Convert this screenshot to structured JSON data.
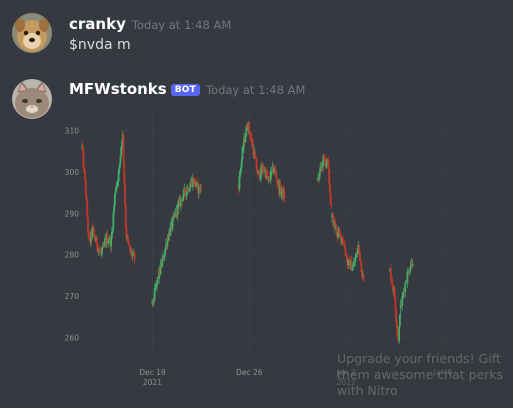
{
  "messages": [
    {
      "author": "cranky",
      "timestamp": "Today at 1:48 AM",
      "text": "$nvda m"
    },
    {
      "author": "MFWstonks",
      "badge": "BOT",
      "timestamp": "Today at 1:48 AM"
    }
  ],
  "nitro_overlay": {
    "text": "Upgrade your friends! Gift them awesome chat perks with Nitro"
  },
  "colors": {
    "up": "#3dae6b",
    "down": "#c0392b",
    "background": "#36393f",
    "bot_badge": "#5865f2"
  },
  "chart_data": {
    "type": "candlestick",
    "ylim": [
      255,
      315
    ],
    "yticks": [
      260,
      270,
      280,
      290,
      300,
      310
    ],
    "xticks": [
      {
        "x": 8,
        "label": "Dec 19",
        "sublabel": "2021"
      },
      {
        "x": 19,
        "label": "Dec 26",
        "sublabel": ""
      },
      {
        "x": 30,
        "label": "Jan 2",
        "sublabel": "2022"
      },
      {
        "x": 41,
        "label": "Jan 9",
        "sublabel": ""
      }
    ],
    "xlim": [
      0,
      46
    ],
    "segments": [
      {
        "x0": 0.0,
        "x1": 2.2,
        "path": [
          [
            0,
            306
          ],
          [
            0.4,
            296
          ],
          [
            0.8,
            282
          ],
          [
            1.2,
            286
          ],
          [
            1.6,
            283
          ],
          [
            2.2,
            280
          ]
        ]
      },
      {
        "x0": 2.2,
        "x1": 4.2,
        "path": [
          [
            2.2,
            280
          ],
          [
            2.8,
            284
          ],
          [
            3.3,
            283
          ],
          [
            3.8,
            296
          ],
          [
            4.2,
            300
          ]
        ]
      },
      {
        "x0": 4.2,
        "x1": 6.0,
        "path": [
          [
            4.2,
            300
          ],
          [
            4.6,
            310
          ],
          [
            5.0,
            285
          ],
          [
            5.4,
            281
          ],
          [
            6.0,
            279
          ]
        ]
      },
      {
        "x0": 8.0,
        "x1": 10.2,
        "path": [
          [
            8.0,
            268
          ],
          [
            8.6,
            274
          ],
          [
            9.2,
            279
          ],
          [
            9.7,
            284
          ],
          [
            10.2,
            287
          ]
        ]
      },
      {
        "x0": 10.2,
        "x1": 12.0,
        "path": [
          [
            10.2,
            287
          ],
          [
            10.8,
            291
          ],
          [
            11.4,
            294
          ],
          [
            12.0,
            296
          ]
        ]
      },
      {
        "x0": 12.0,
        "x1": 13.6,
        "path": [
          [
            12.0,
            296
          ],
          [
            12.6,
            298
          ],
          [
            13.2,
            296
          ],
          [
            13.6,
            296
          ]
        ]
      },
      {
        "x0": 17.8,
        "x1": 19.4,
        "path": [
          [
            17.8,
            297
          ],
          [
            18.3,
            306
          ],
          [
            18.8,
            312
          ],
          [
            19.4,
            306
          ]
        ]
      },
      {
        "x0": 19.4,
        "x1": 21.2,
        "path": [
          [
            19.4,
            306
          ],
          [
            20.0,
            299
          ],
          [
            20.6,
            301
          ],
          [
            21.2,
            298
          ]
        ]
      },
      {
        "x0": 21.2,
        "x1": 23.0,
        "path": [
          [
            21.2,
            298
          ],
          [
            21.8,
            301
          ],
          [
            22.4,
            296
          ],
          [
            23.0,
            294
          ]
        ]
      },
      {
        "x0": 26.8,
        "x1": 28.4,
        "path": [
          [
            26.8,
            298
          ],
          [
            27.4,
            303
          ],
          [
            27.9,
            302
          ],
          [
            28.4,
            289
          ]
        ]
      },
      {
        "x0": 28.4,
        "x1": 30.2,
        "path": [
          [
            28.4,
            289
          ],
          [
            29.0,
            285
          ],
          [
            29.6,
            284
          ],
          [
            30.2,
            278
          ]
        ]
      },
      {
        "x0": 30.2,
        "x1": 32.0,
        "path": [
          [
            30.2,
            278
          ],
          [
            30.8,
            277
          ],
          [
            31.4,
            282
          ],
          [
            32.0,
            273
          ]
        ]
      },
      {
        "x0": 35.0,
        "x1": 36.2,
        "path": [
          [
            35.0,
            276
          ],
          [
            35.5,
            270
          ],
          [
            35.9,
            259
          ],
          [
            36.2,
            267
          ]
        ]
      },
      {
        "x0": 36.2,
        "x1": 37.6,
        "path": [
          [
            36.2,
            267
          ],
          [
            36.7,
            273
          ],
          [
            37.2,
            277
          ],
          [
            37.6,
            279
          ]
        ]
      }
    ]
  }
}
